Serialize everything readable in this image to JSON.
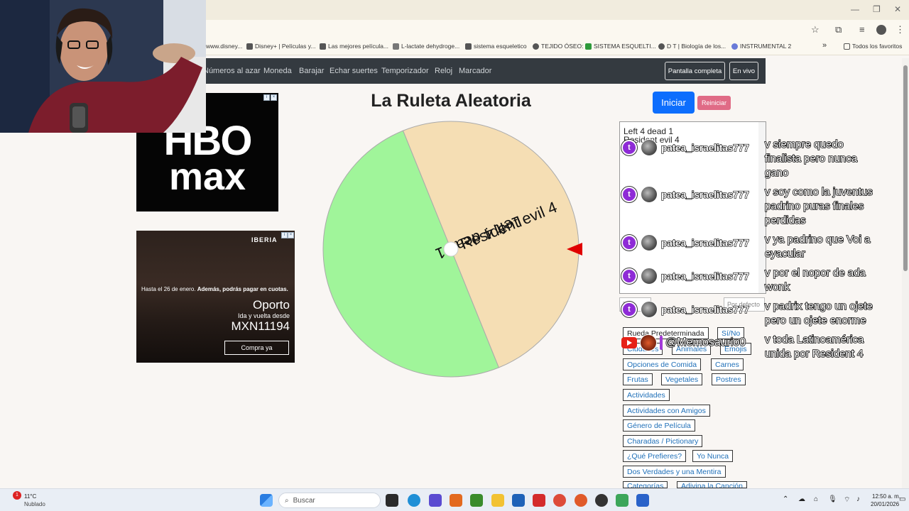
{
  "browser": {
    "bookmarks": [
      "www.disney...",
      "Disney+ | Películas y...",
      "Las mejores película...",
      "L-lactate dehydroge...",
      "sistema esqueletico",
      "TEJIDO ÓSEO:",
      "SISTEMA ESQUELTI...",
      "D T | Biología de los...",
      "INSTRUMENTAL 2"
    ],
    "more_bookmarks": "»",
    "all_favorites": "Todos los favoritos"
  },
  "nav": {
    "items": [
      "Números al azar",
      "Moneda",
      "Barajar",
      "Echar suertes",
      "Temporizador",
      "Reloj",
      "Marcador"
    ],
    "fullscreen_label": "Pantalla completa",
    "live_label": "En vivo"
  },
  "ads": {
    "hbo": {
      "line1": "HBO",
      "line2": "max"
    },
    "iberia": {
      "brand": "IBERIA",
      "promo_line1": "Hasta el 26 de enero.",
      "promo_line1_bold": "Además, podrás pagar en cuotas.",
      "destination": "Oporto",
      "subtitle": "Ida y vuelta desde",
      "price": "MXN11194",
      "cta": "Compra ya"
    }
  },
  "main": {
    "title": "La Ruleta Aleatoria",
    "start_label": "Iniciar",
    "reset_label": "Reiniciar"
  },
  "wheel": {
    "segments": [
      {
        "label": "Left 4 dead 1",
        "color": "#a0f59a"
      },
      {
        "label": "Resident evil 4",
        "color": "#f5deb4"
      }
    ],
    "pointer_color": "#e00000"
  },
  "options_list": [
    "Left 4 dead 1",
    "Resident evil 4"
  ],
  "fields": {
    "left": "Ti...",
    "right": "Por defecto"
  },
  "presets": {
    "row1": [
      "Rueda Predeterminada",
      "Sí/No"
    ],
    "row2": [
      "Ciudades",
      "Animales",
      "Emojis"
    ],
    "row3": [
      "Opciones de Comida",
      "Carnes"
    ],
    "row4": [
      "Frutas",
      "Vegetales",
      "Postres"
    ],
    "row5": [
      "Actividades"
    ],
    "row6": [
      "Actividades con Amigos"
    ],
    "row7": [
      "Género de Película"
    ],
    "row8": [
      "Charadas / Pictionary"
    ],
    "row9": [
      "¿Qué Prefieres?",
      "Yo Nunca"
    ],
    "row10": [
      "Dos Verdades y una Mentira"
    ],
    "row11": [
      "Categorías",
      "Adivina la Canción"
    ]
  },
  "chat": {
    "username": "patea_israelitas777",
    "messages": [
      [
        "v siempre quedo",
        "finalista pero nunca",
        "gano"
      ],
      [
        "v soy como la juventus",
        "padrino puras finales",
        "perdidas"
      ],
      [
        "v ya padrino que Voi a",
        "eyacular"
      ],
      [
        "v por el nopor de ada",
        "wonk"
      ],
      [
        "v padrix tengo un ojete",
        "pero un ojete enorme"
      ],
      [
        "v toda Latinoamérica",
        "unida por Resident 4"
      ]
    ]
  },
  "stream": {
    "handle": "@Memosaurio0"
  },
  "taskbar": {
    "weather_temp": "11°C",
    "weather_desc": "Nublado",
    "weather_badge": "1",
    "search_placeholder": "Buscar",
    "time": "12:50 a. m.",
    "date": "20/01/2026"
  }
}
